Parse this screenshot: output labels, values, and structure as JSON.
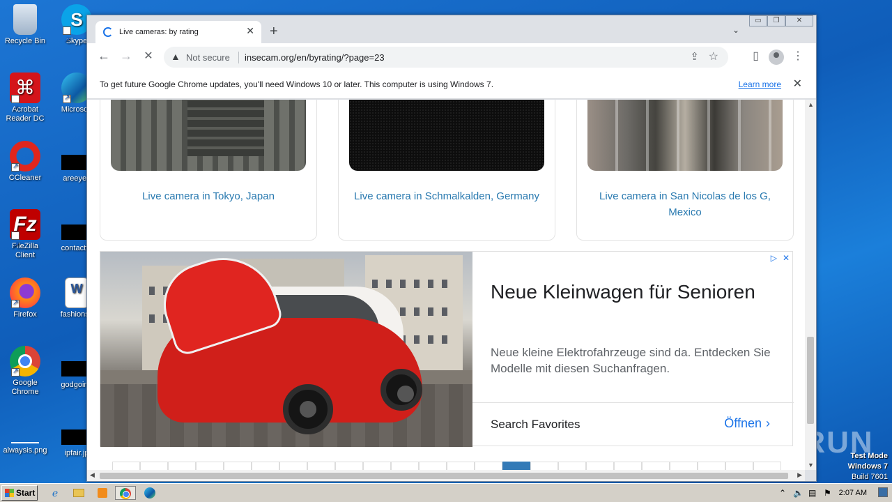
{
  "desktop": {
    "icons": [
      {
        "label": "Recycle Bin"
      },
      {
        "label": "Skype"
      },
      {
        "label": "Acrobat Reader DC"
      },
      {
        "label": "Microsoft"
      },
      {
        "label": "CCleaner"
      },
      {
        "label": "areeyes"
      },
      {
        "label": "FileZilla Client"
      },
      {
        "label": "contactfri"
      },
      {
        "label": "Firefox"
      },
      {
        "label": "fashionsy"
      },
      {
        "label": "Google Chrome"
      },
      {
        "label": "godgoing"
      },
      {
        "label": "alwaysis.png"
      },
      {
        "label": "ipfair.jp"
      }
    ]
  },
  "browser": {
    "tab": {
      "title": "Live cameras: by rating",
      "close": "✕"
    },
    "new_tab": "+",
    "tab_menu": "⌄",
    "window_controls": {
      "minimize": "▭",
      "restore": "❐",
      "close": "✕"
    },
    "nav": {
      "back": "←",
      "forward": "→",
      "reload": "✕"
    },
    "omnibox": {
      "security_icon": "▲",
      "security_text": "Not secure",
      "url": "insecam.org/en/byrating/?page=23",
      "share": "⇪",
      "star": "☆"
    },
    "toolbar_icons": {
      "side_panel": "▯",
      "menu": "⋮"
    },
    "infobar": {
      "message": "To get future Google Chrome updates, you'll need Windows 10 or later. This computer is using Windows 7.",
      "link": "Learn more",
      "close": "✕"
    }
  },
  "page": {
    "cameras": [
      {
        "link": "Live camera in Tokyo, Japan"
      },
      {
        "link": "Live camera in Schmalkalden, Germany"
      },
      {
        "link": "Live camera in San Nicolas de los G, Mexico"
      }
    ],
    "ad": {
      "headline": "Neue Kleinwagen für Senioren",
      "description": "Neue kleine Elektrofahrzeuge sind da. Entdecken Sie Modelle mit diesen Suchanfragen.",
      "favorites": "Search Favorites",
      "cta": "Öffnen",
      "cta_chevron": "›",
      "adchoices": "▷",
      "ad_close": "✕"
    },
    "pager": {
      "count": 24,
      "active_index": 14
    }
  },
  "overlay": {
    "watermark": "ANY RUN",
    "test_mode": "Test Mode",
    "os": "Windows 7",
    "build": "Build 7601"
  },
  "taskbar": {
    "start": "Start",
    "clock": "2:07 AM"
  }
}
